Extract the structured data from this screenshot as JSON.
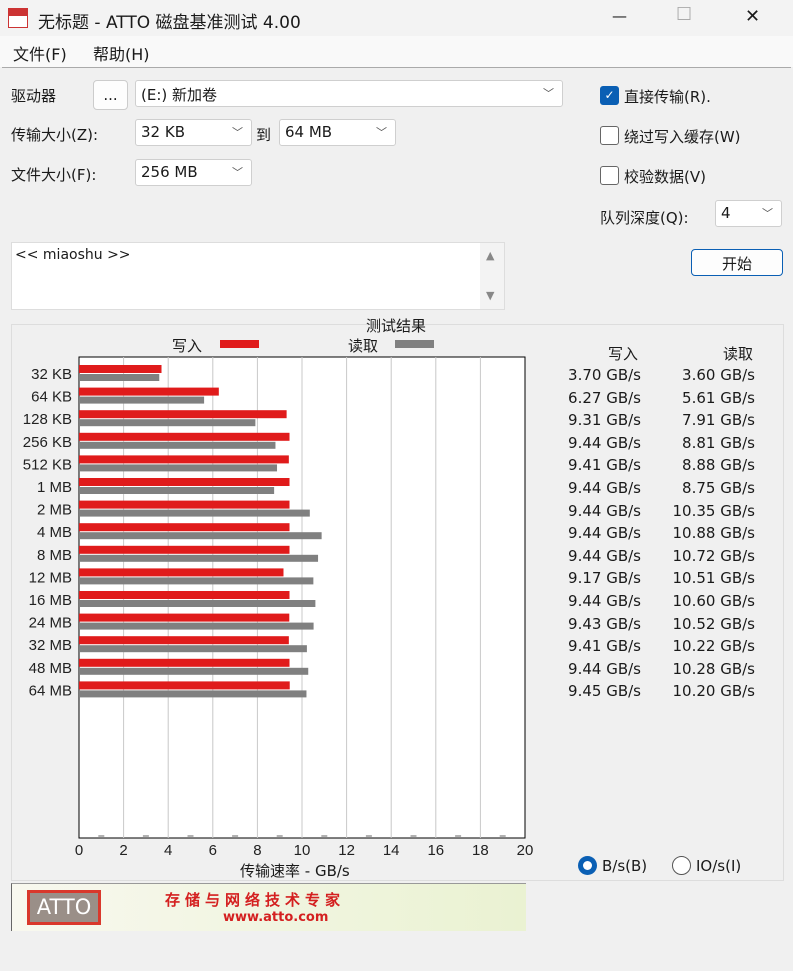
{
  "window": {
    "title": "无标题 - ATTO 磁盘基准测试 4.00",
    "minimize": "—",
    "maximize": "☐",
    "close": "✕"
  },
  "menu": {
    "file": "文件(F)",
    "help": "帮助(H)"
  },
  "settings": {
    "drive_label": "驱动器",
    "browse_label": "...",
    "drive_value": "(E:) 新加卷",
    "transfer_label": "传输大小(Z):",
    "transfer_from": "32 KB",
    "to_label": "到",
    "transfer_to": "64 MB",
    "file_size_label": "文件大小(F):",
    "file_size": "256 MB",
    "direct_io": {
      "label": "直接传输(R).",
      "checked": true
    },
    "bypass_cache": {
      "label": "绕过写入缓存(W)",
      "checked": false
    },
    "verify": {
      "label": "校验数据(V)",
      "checked": false
    },
    "queue_label": "队列深度(Q):",
    "queue_value": "4",
    "start_label": "开始",
    "description": "<< miaoshu >>"
  },
  "results": {
    "title": "测试结果",
    "write_label": "写入",
    "read_label": "读取",
    "col_write": "写入",
    "col_read": "读取",
    "rows": [
      {
        "size": "32 KB",
        "write": "3.70 GB/s",
        "read": "3.60 GB/s"
      },
      {
        "size": "64 KB",
        "write": "6.27 GB/s",
        "read": "5.61 GB/s"
      },
      {
        "size": "128 KB",
        "write": "9.31 GB/s",
        "read": "7.91 GB/s"
      },
      {
        "size": "256 KB",
        "write": "9.44 GB/s",
        "read": "8.81 GB/s"
      },
      {
        "size": "512 KB",
        "write": "9.41 GB/s",
        "read": "8.88 GB/s"
      },
      {
        "size": "1 MB",
        "write": "9.44 GB/s",
        "read": "8.75 GB/s"
      },
      {
        "size": "2 MB",
        "write": "9.44 GB/s",
        "read": "10.35 GB/s"
      },
      {
        "size": "4 MB",
        "write": "9.44 GB/s",
        "read": "10.88 GB/s"
      },
      {
        "size": "8 MB",
        "write": "9.44 GB/s",
        "read": "10.72 GB/s"
      },
      {
        "size": "12 MB",
        "write": "9.17 GB/s",
        "read": "10.51 GB/s"
      },
      {
        "size": "16 MB",
        "write": "9.44 GB/s",
        "read": "10.60 GB/s"
      },
      {
        "size": "24 MB",
        "write": "9.43 GB/s",
        "read": "10.52 GB/s"
      },
      {
        "size": "32 MB",
        "write": "9.41 GB/s",
        "read": "10.22 GB/s"
      },
      {
        "size": "48 MB",
        "write": "9.44 GB/s",
        "read": "10.28 GB/s"
      },
      {
        "size": "64 MB",
        "write": "9.45 GB/s",
        "read": "10.20 GB/s"
      }
    ],
    "unit_bs": {
      "label": "B/s(B)",
      "selected": true
    },
    "unit_ios": {
      "label": "IO/s(I)",
      "selected": false
    }
  },
  "chart_data": {
    "type": "bar",
    "orientation": "horizontal",
    "title": "测试结果",
    "xlabel": "传输速率 - GB/s",
    "categories": [
      "32 KB",
      "64 KB",
      "128 KB",
      "256 KB",
      "512 KB",
      "1 MB",
      "2 MB",
      "4 MB",
      "8 MB",
      "12 MB",
      "16 MB",
      "24 MB",
      "32 MB",
      "48 MB",
      "64 MB"
    ],
    "series": [
      {
        "name": "写入",
        "color": "#e01b1b",
        "values": [
          3.7,
          6.27,
          9.31,
          9.44,
          9.41,
          9.44,
          9.44,
          9.44,
          9.44,
          9.17,
          9.44,
          9.43,
          9.41,
          9.44,
          9.45
        ]
      },
      {
        "name": "读取",
        "color": "#808080",
        "values": [
          3.6,
          5.61,
          7.91,
          8.81,
          8.88,
          8.75,
          10.35,
          10.88,
          10.72,
          10.51,
          10.6,
          10.52,
          10.22,
          10.28,
          10.2
        ]
      }
    ],
    "xlim": [
      0,
      20
    ],
    "xticks": [
      "0",
      "2",
      "4",
      "6",
      "8",
      "10",
      "12",
      "14",
      "16",
      "18",
      "20"
    ],
    "grid": true,
    "legend": "top"
  },
  "banner": {
    "logo": "ATTO",
    "slogan": "存储与网络技术专家",
    "url": "www.atto.com"
  }
}
